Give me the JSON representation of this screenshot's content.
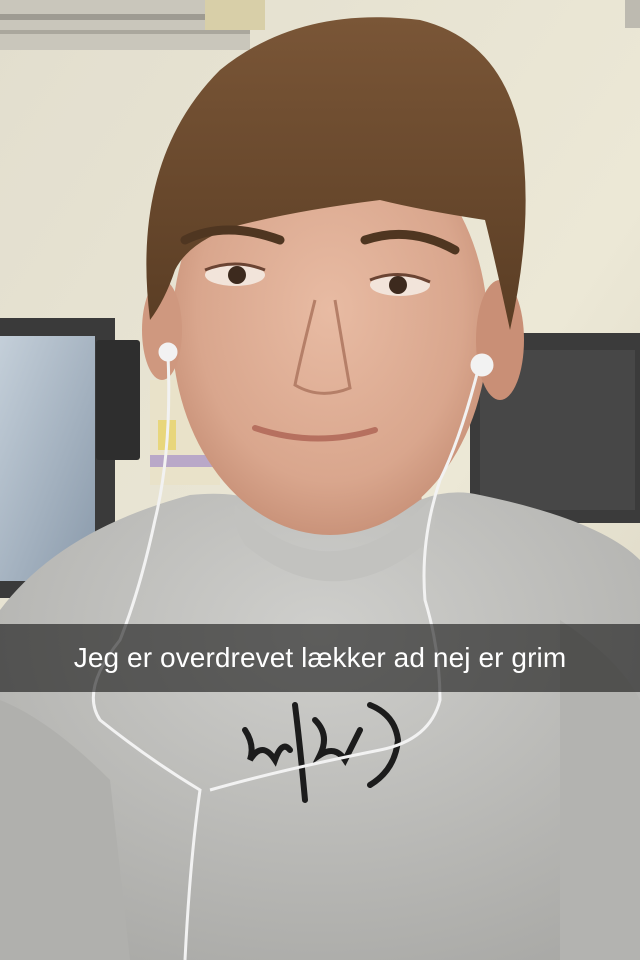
{
  "snap": {
    "caption": "Jeg er overdrevet lækker ad nej er grim",
    "caption_bar_color": "#000000"
  },
  "photo": {
    "subject": "selfie-person",
    "colors": {
      "wall": "#e9e5d3",
      "hair": "#6a4a2c",
      "skin": "#dcab92",
      "sweater": "#b9b9b6",
      "monitor_frame": "#3a3a3a",
      "monitor_screen": "#a9b7c5",
      "cabinet": "#3b3b3b"
    }
  }
}
